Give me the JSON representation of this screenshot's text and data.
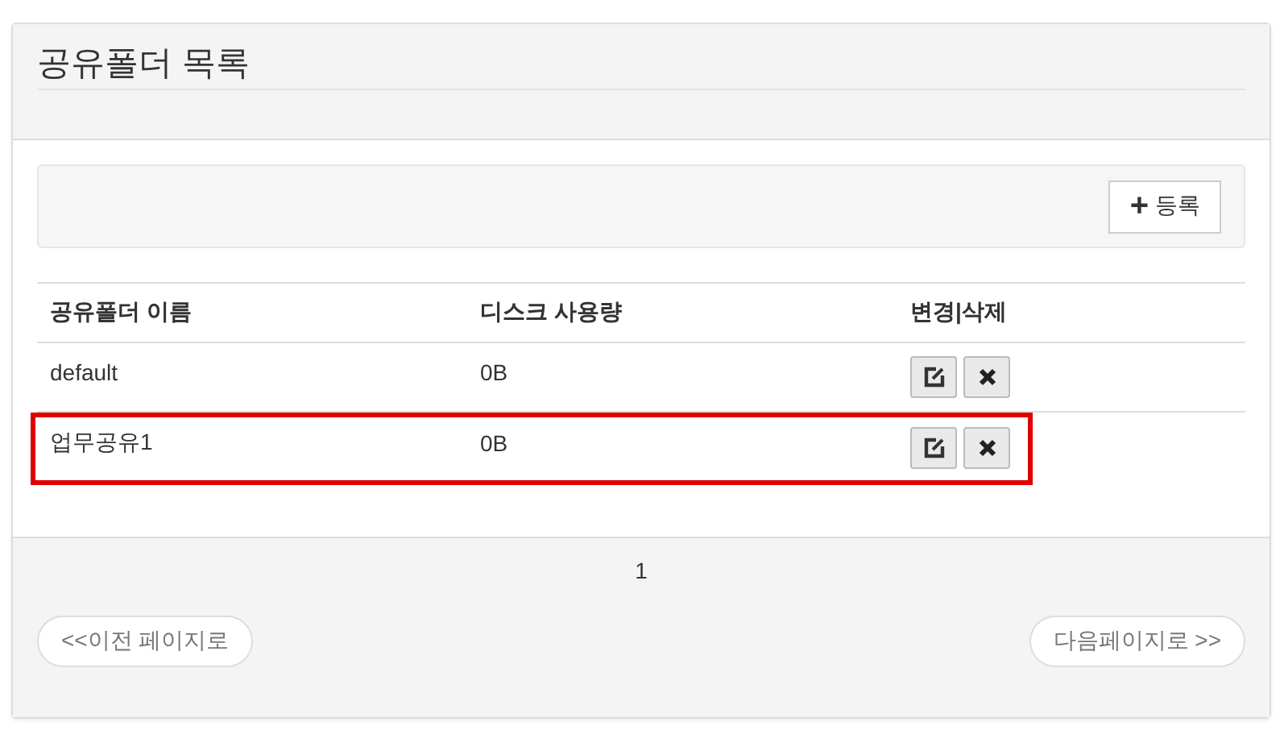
{
  "panel": {
    "title": "공유폴더 목록"
  },
  "toolbar": {
    "add_button": {
      "icon": "+",
      "label": "등록"
    }
  },
  "table": {
    "columns": [
      "공유폴더 이름",
      "디스크 사용량",
      "변경|삭제"
    ],
    "rows": [
      {
        "name": "default",
        "usage": "0B",
        "highlighted": false
      },
      {
        "name": "업무공유1",
        "usage": "0B",
        "highlighted": true
      }
    ]
  },
  "pagination": {
    "pages": [
      {
        "label": "1",
        "selected": true
      }
    ],
    "prev": "<<이전 페이지로",
    "next": "다음페이지로 >>"
  }
}
